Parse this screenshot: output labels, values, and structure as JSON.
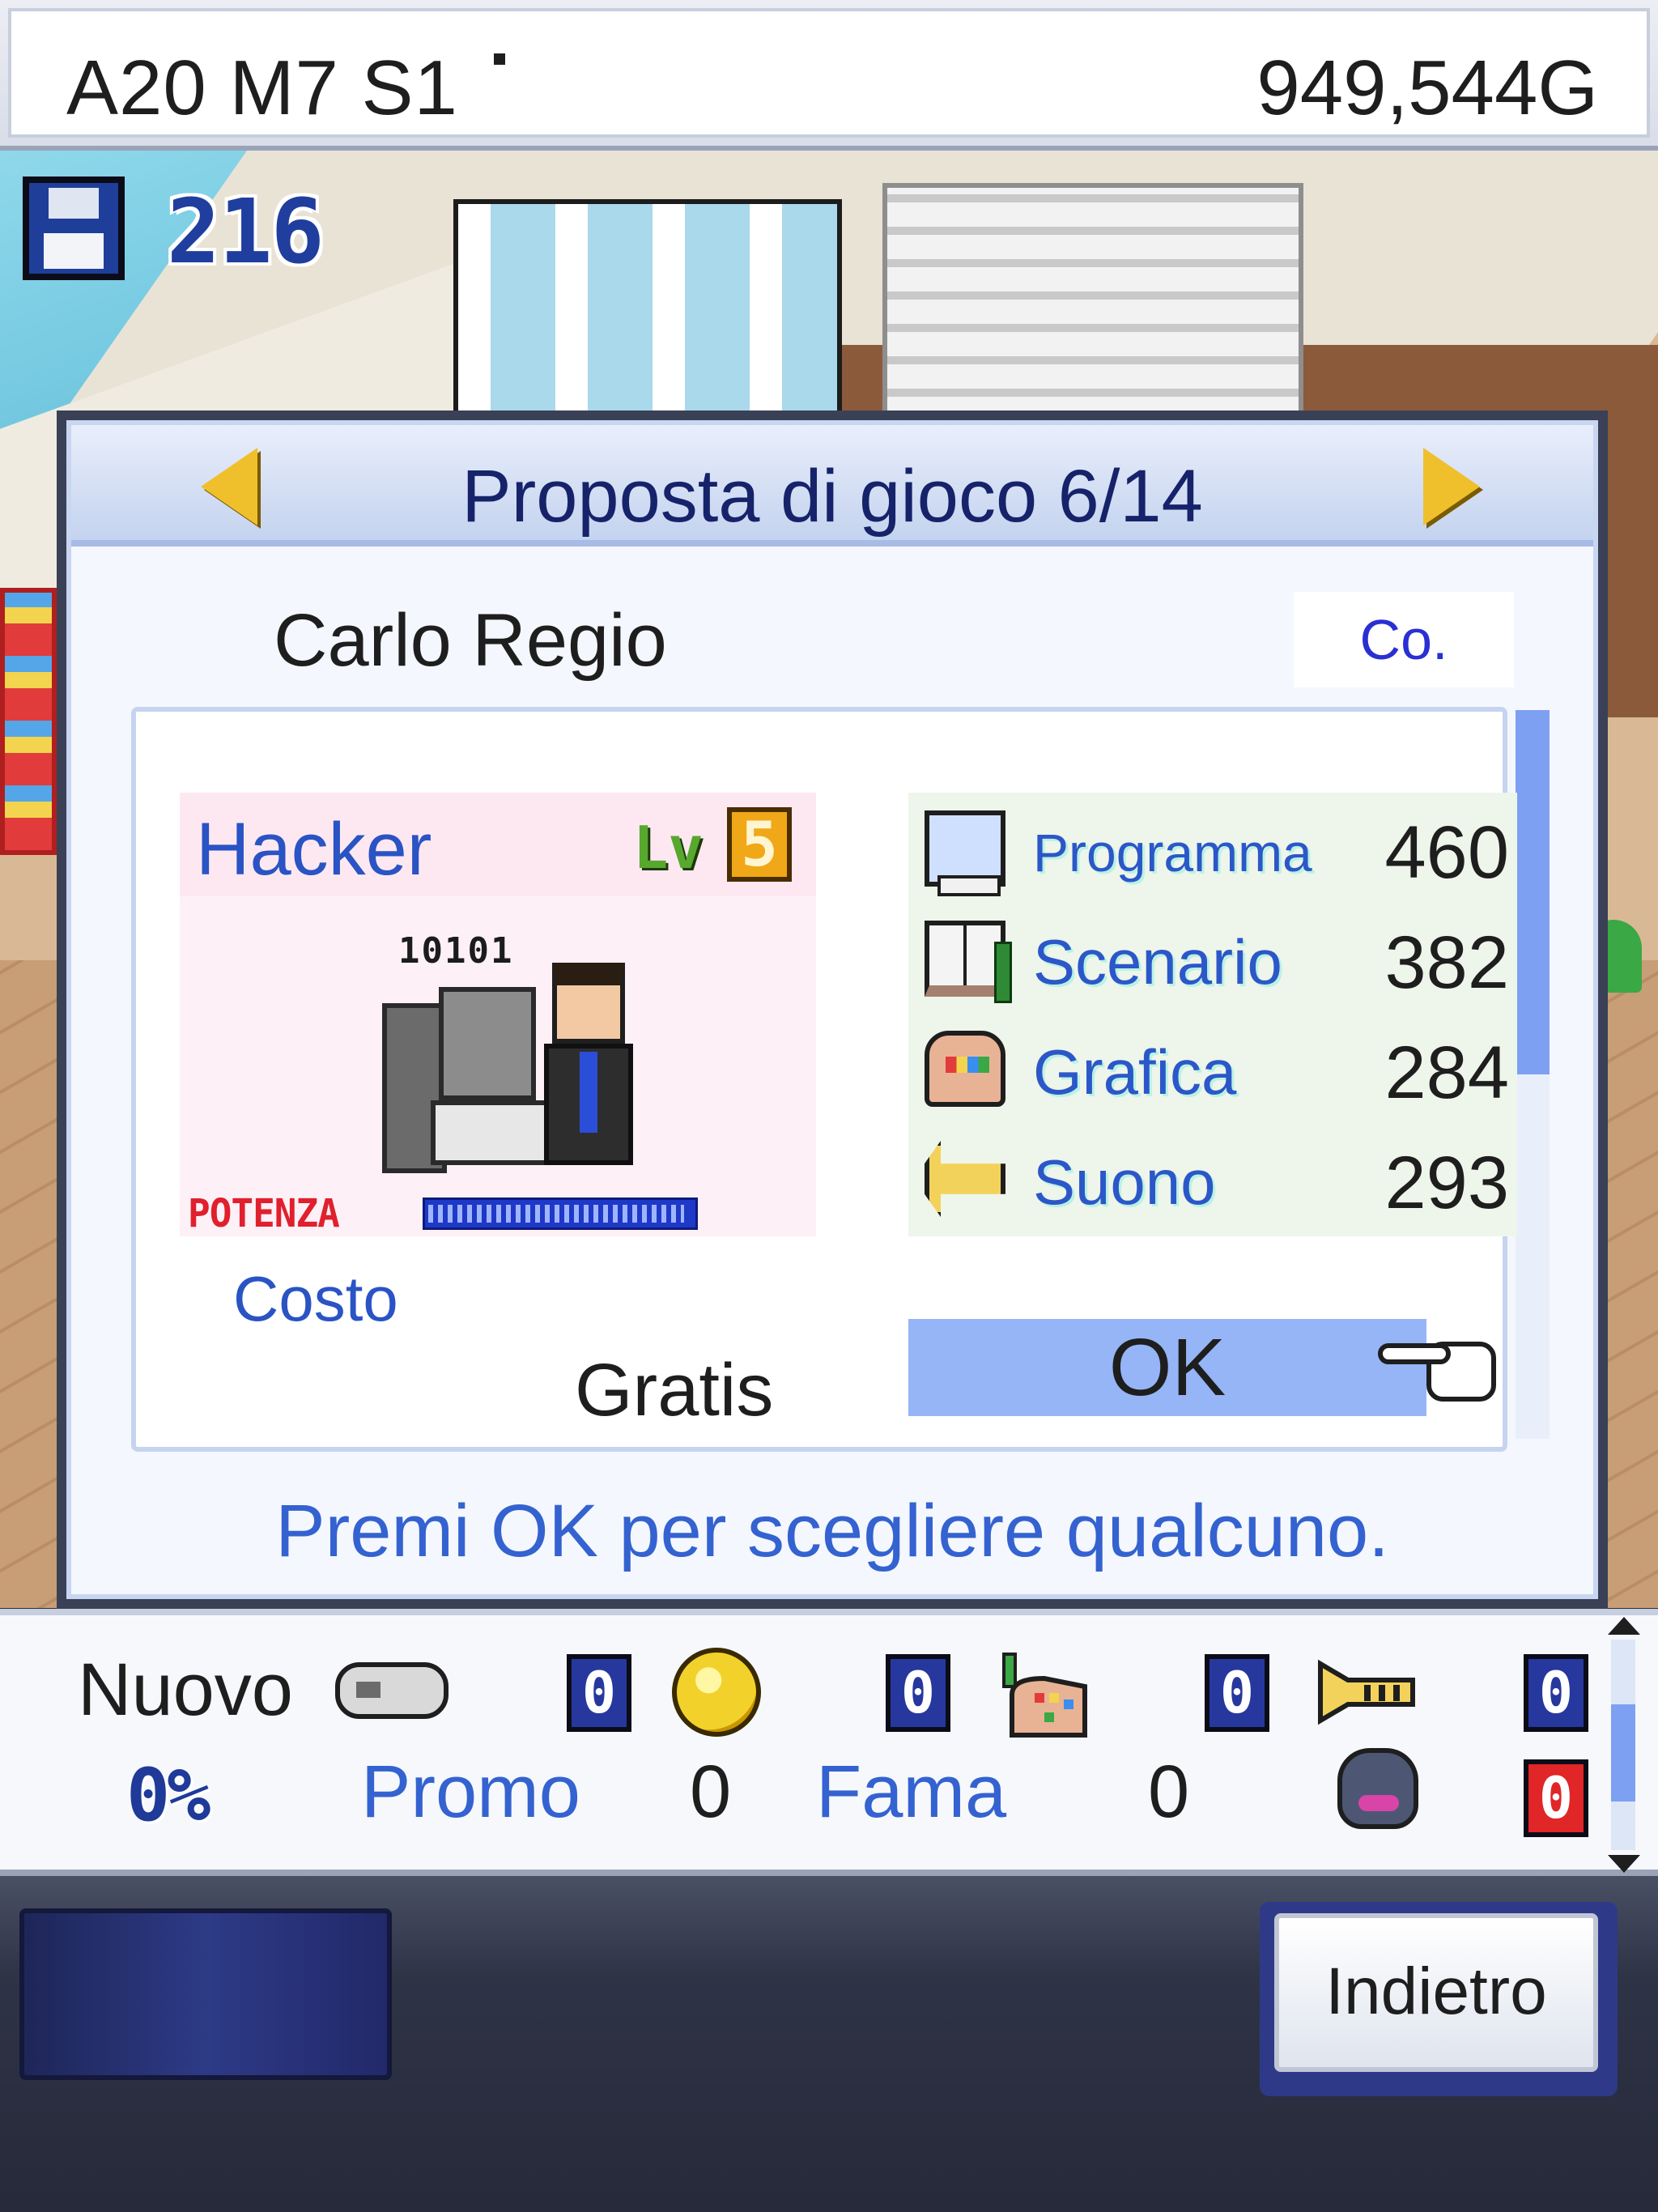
{
  "topbar": {
    "date": "A20 M7 S1",
    "money": "949,544G"
  },
  "save": {
    "icon": "floppy-disk-icon",
    "count": "216"
  },
  "dialog": {
    "title": "Proposta di gioco 6/14",
    "person_name": "Carlo Regio",
    "company_button": "Co.",
    "job": "Hacker",
    "level_label": "Lv",
    "level_value": "5",
    "portrait_binary": "10101",
    "power_label": "POTENZA",
    "power_fill_fraction": 0.97,
    "stats": [
      {
        "icon": "computer-icon",
        "name": "Programma",
        "value": "460"
      },
      {
        "icon": "book-icon",
        "name": "Scenario",
        "value": "382"
      },
      {
        "icon": "palette-icon",
        "name": "Grafica",
        "value": "284"
      },
      {
        "icon": "horn-icon",
        "name": "Suono",
        "value": "293"
      }
    ],
    "cost_label": "Costo",
    "cost_value": "Gratis",
    "ok_label": "OK",
    "hint": "Premi OK per scegliere qualcuno."
  },
  "status": {
    "nuovo_label": "Nuovo",
    "badges": [
      "0",
      "0",
      "0",
      "0"
    ],
    "percent": "0%",
    "promo_label": "Promo",
    "promo_value": "0",
    "fama_label": "Fama",
    "fama_value": "0",
    "bugs_value": "0"
  },
  "footer": {
    "back_label": "Indietro"
  },
  "colors": {
    "accent_blue": "#3462d0",
    "ok_highlight": "#96b5f6",
    "dialog_border": "#3a4156"
  }
}
